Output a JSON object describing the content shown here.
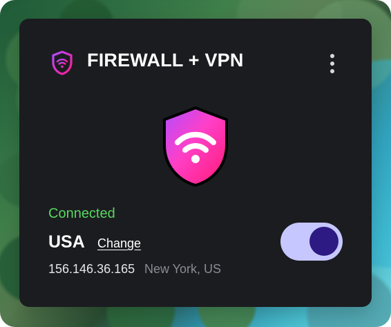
{
  "header": {
    "title": "FIREWALL + VPN",
    "brand_icon": "shield-wifi-icon",
    "menu_icon": "more-vertical-icon"
  },
  "main": {
    "status_text": "Connected",
    "country": "USA",
    "change_label": "Change",
    "ip_address": "156.146.36.165",
    "location": "New York, US",
    "hero_icon": "shield-wifi-icon",
    "toggle_enabled": true
  },
  "colors": {
    "connected": "#57d85e",
    "card_background": "#1b1c20",
    "toggle_track": "#c6c7ff",
    "toggle_thumb": "#2d1a82",
    "shield_gradient_start": "#a542ff",
    "shield_gradient_end": "#ff1b8d"
  }
}
